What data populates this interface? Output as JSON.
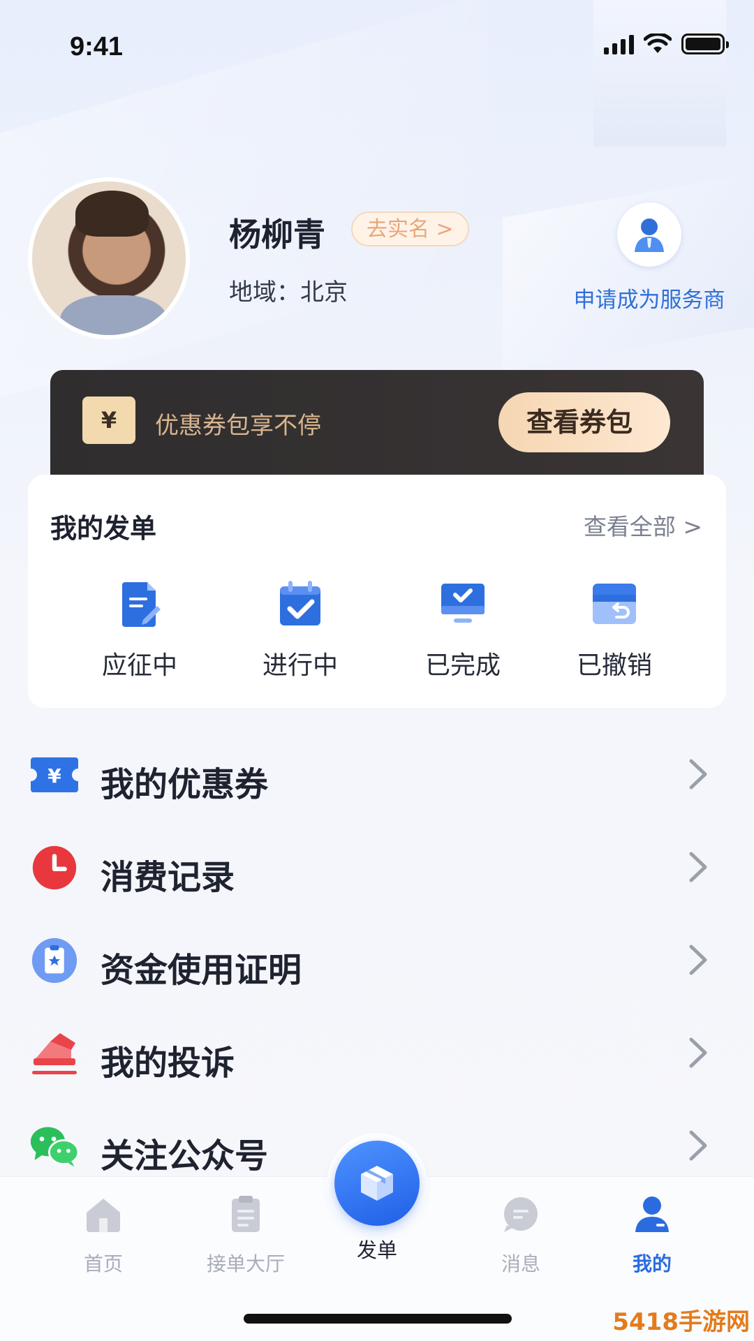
{
  "status_bar": {
    "time": "9:41"
  },
  "profile": {
    "name": "杨柳青",
    "verify_label": "去实名 >",
    "region": "地域：北京",
    "apply_label": "申请成为服务商"
  },
  "coupon_banner": {
    "text": "优惠券包享不停",
    "button_label": "查看券包",
    "ticket_symbol": "¥"
  },
  "orders": {
    "title": "我的发单",
    "view_all": "查看全部 >",
    "items": [
      {
        "label": "应征中",
        "icon": "document-edit-icon"
      },
      {
        "label": "进行中",
        "icon": "calendar-check-icon"
      },
      {
        "label": "已完成",
        "icon": "monitor-check-icon"
      },
      {
        "label": "已撤销",
        "icon": "revoke-icon"
      }
    ]
  },
  "menu": [
    {
      "label": "我的优惠券",
      "icon": "coupon-icon",
      "color": "#3b7df0"
    },
    {
      "label": "消费记录",
      "icon": "clock-icon",
      "color": "#e8383d"
    },
    {
      "label": "资金使用证明",
      "icon": "certificate-icon",
      "color": "#4f86ee"
    },
    {
      "label": "我的投诉",
      "icon": "complaint-icon",
      "color": "#e8444a"
    },
    {
      "label": "关注公众号",
      "icon": "wechat-icon",
      "color": "#2bbf5c"
    }
  ],
  "tabbar": {
    "items": [
      {
        "label": "首页",
        "icon": "home-icon"
      },
      {
        "label": "接单大厅",
        "icon": "clipboard-icon"
      },
      {
        "label": "发单",
        "icon": "box-icon"
      },
      {
        "label": "消息",
        "icon": "message-icon"
      },
      {
        "label": "我的",
        "icon": "user-icon"
      }
    ],
    "active": "我的"
  },
  "watermark": "5418手游网",
  "colors": {
    "accent": "#2a6be0",
    "banner_bg": "#2f2d2e",
    "banner_text": "#d8b58e"
  }
}
